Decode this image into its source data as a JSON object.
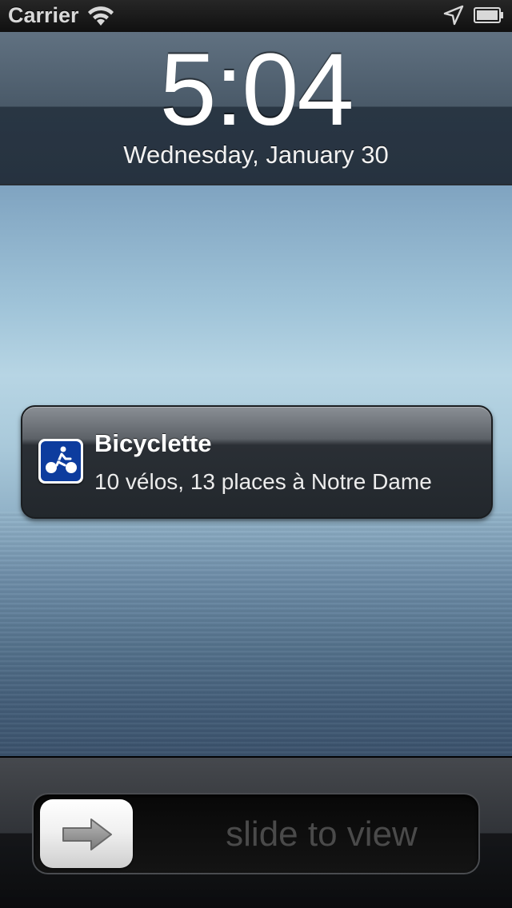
{
  "status_bar": {
    "carrier": "Carrier",
    "wifi_icon": "wifi-icon",
    "location_icon": "location-arrow-icon",
    "battery_icon": "battery-full-icon"
  },
  "lock_screen": {
    "time": "5:04",
    "date": "Wednesday, January 30"
  },
  "notification": {
    "app_name": "Bicyclette",
    "message": "10 vélos, 13 places à Notre Dame",
    "icon": "bicycle-icon",
    "icon_color": "#0d3c9e"
  },
  "unlock_slider": {
    "label": "slide to view",
    "knob_icon": "arrow-right-icon"
  }
}
